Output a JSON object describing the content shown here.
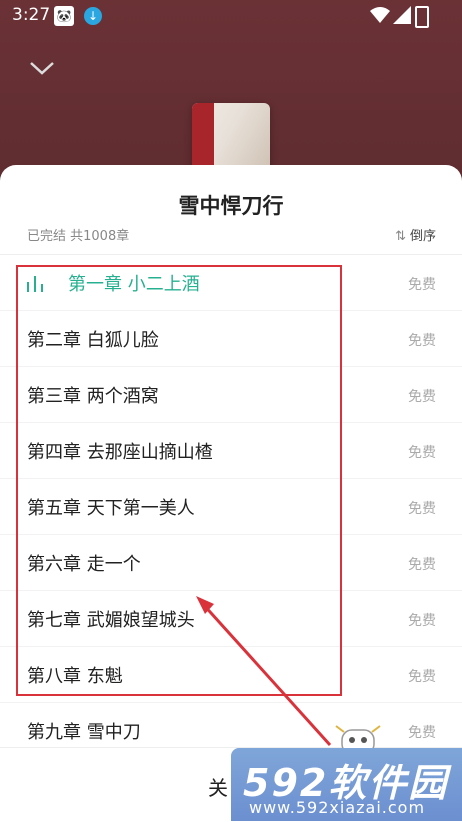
{
  "status_bar": {
    "time": "3:27"
  },
  "book": {
    "title": "雪中悍刀行",
    "status": "已完结 共1008章",
    "sort_label": "倒序",
    "sort_icon": "⇅"
  },
  "chapters": [
    {
      "title": "第一章 小二上酒",
      "price": "免费",
      "active": true
    },
    {
      "title": "第二章 白狐儿脸",
      "price": "免费"
    },
    {
      "title": "第三章 两个酒窝",
      "price": "免费"
    },
    {
      "title": "第四章 去那座山摘山楂",
      "price": "免费"
    },
    {
      "title": "第五章 天下第一美人",
      "price": "免费"
    },
    {
      "title": "第六章 走一个",
      "price": "免费"
    },
    {
      "title": "第七章 武媚娘望城头",
      "price": "免费"
    },
    {
      "title": "第八章 东魁",
      "price": "免费"
    },
    {
      "title": "第九章 雪中刀",
      "price": "免费"
    }
  ],
  "bottom": {
    "close_label": "关"
  },
  "watermark": {
    "main": "592软件园",
    "url": "www.592xiazai.com"
  },
  "colors": {
    "active": "#27b090",
    "annotation": "#d9323a"
  }
}
